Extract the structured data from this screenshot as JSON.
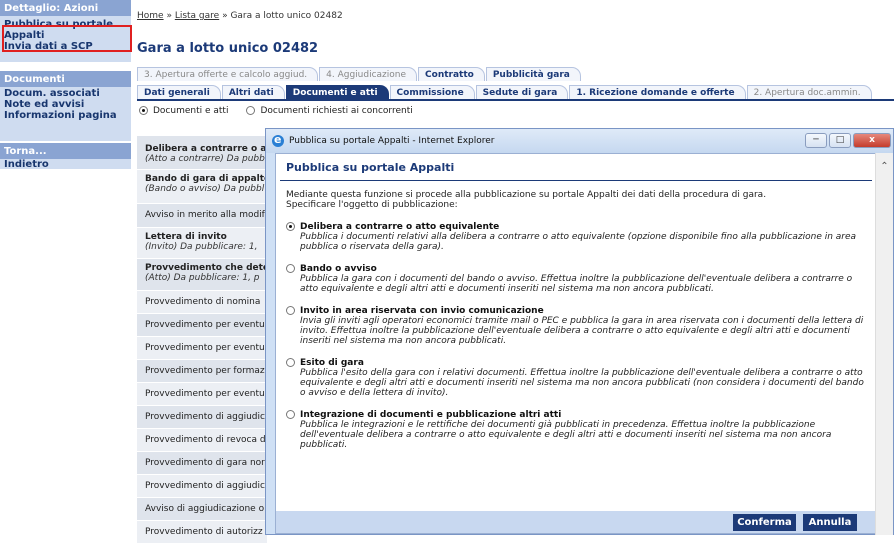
{
  "sidebar": {
    "sections": [
      {
        "header": "Dettaglio: Azioni",
        "items": [
          "Pubblica su portale Appalti",
          "Invia dati a SCP"
        ]
      },
      {
        "header": "Documenti",
        "items": [
          "Docum. associati",
          "Note ed avvisi",
          "Informazioni pagina"
        ]
      },
      {
        "header": "Torna...",
        "items": [
          "Indietro"
        ]
      }
    ]
  },
  "breadcrumb": {
    "home": "Home",
    "sep1": " » ",
    "list": "Lista gare",
    "sep2": " » ",
    "current": "Gara a lotto unico 02482"
  },
  "page_title": "Gara a lotto unico 02482",
  "tabs_row1": [
    "3. Apertura offerte e calcolo aggiud.",
    "4. Aggiudicazione",
    "Contratto",
    "Pubblicità gara"
  ],
  "tabs_row2": [
    "Dati generali",
    "Altri dati",
    "Documenti e atti",
    "Commissione",
    "Sedute di gara",
    "1. Ricezione domande e offerte",
    "2. Apertura doc.ammin."
  ],
  "radio_options": [
    "Documenti e atti",
    "Documenti richiesti ai concorrenti"
  ],
  "doc_list": [
    {
      "title": "Delibera a contrarre o a",
      "sub": "(Atto a contrarre) Da pubb"
    },
    {
      "title": "Bando di gara di appalto",
      "sub": "(Bando o avviso) Da pubbl"
    },
    {
      "title": "Avviso in merito alla modif",
      "sub": ""
    },
    {
      "title": "Lettera di invito",
      "sub": "(Invito) Da pubblicare: 1,"
    },
    {
      "title": "Provvedimento che dete",
      "sub": "(Atto) Da pubblicare: 1, p"
    },
    {
      "title": "Provvedimento di nomina",
      "sub": ""
    },
    {
      "title": "Provvedimento per eventu",
      "sub": ""
    },
    {
      "title": "Provvedimento per eventu",
      "sub": ""
    },
    {
      "title": "Provvedimento per formaz",
      "sub": ""
    },
    {
      "title": "Provvedimento per eventu",
      "sub": ""
    },
    {
      "title": "Provvedimento di aggiudic",
      "sub": ""
    },
    {
      "title": "Provvedimento di revoca d",
      "sub": ""
    },
    {
      "title": "Provvedimento di gara nor",
      "sub": ""
    },
    {
      "title": "Provvedimento di aggiudic",
      "sub": ""
    },
    {
      "title": "Avviso di aggiudicazione o",
      "sub": ""
    },
    {
      "title": "Provvedimento di autorizz",
      "sub": ""
    }
  ],
  "popup": {
    "window_title": "Pubblica su portale Appalti - Internet Explorer",
    "title": "Pubblica su portale Appalti",
    "intro_line1": "Mediante questa funzione si procede alla pubblicazione su portale Appalti dei dati della procedura di gara.",
    "intro_line2": "Specificare l'oggetto di pubblicazione:",
    "options": [
      {
        "title": "Delibera a contrarre o atto equivalente",
        "desc": "Pubblica i documenti relativi alla delibera a contrarre o atto equivalente (opzione disponibile fino alla pubblicazione in area pubblica o riservata della gara)."
      },
      {
        "title": "Bando o avviso",
        "desc": "Pubblica la gara con i documenti del bando o avviso. Effettua inoltre la pubblicazione dell'eventuale delibera a contrarre o atto equivalente e degli altri atti e documenti inseriti nel sistema ma non ancora pubblicati."
      },
      {
        "title": "Invito in area riservata con invio comunicazione",
        "desc": "Invia gli inviti agli operatori economici tramite mail o PEC e pubblica la gara in area riservata con i documenti della lettera di invito. Effettua inoltre la pubblicazione dell'eventuale delibera a contrarre o atto equivalente e degli altri atti e documenti inseriti nel sistema ma non ancora pubblicati."
      },
      {
        "title": "Esito di gara",
        "desc": "Pubblica l'esito della gara con i relativi documenti. Effettua inoltre la pubblicazione dell'eventuale delibera a contrarre o atto equivalente e degli altri atti e documenti inseriti nel sistema ma non ancora pubblicati (non considera i documenti del bando o avviso e della lettera di invito)."
      },
      {
        "title": "Integrazione di documenti e pubblicazione altri atti",
        "desc": "Pubblica le integrazioni e le rettifiche dei documenti già pubblicati in precedenza. Effettua inoltre la pubblicazione dell'eventuale delibera a contrarre o atto equivalente e degli altri atti e documenti inseriti nel sistema ma non ancora pubblicati."
      }
    ],
    "confirm_label": "Conferma",
    "cancel_label": "Annulla",
    "close_label": "x"
  },
  "colors": {
    "brand_navy": "#1c3a78",
    "sidebar_header": "#8aa4d2",
    "highlight_red": "#e02020"
  }
}
